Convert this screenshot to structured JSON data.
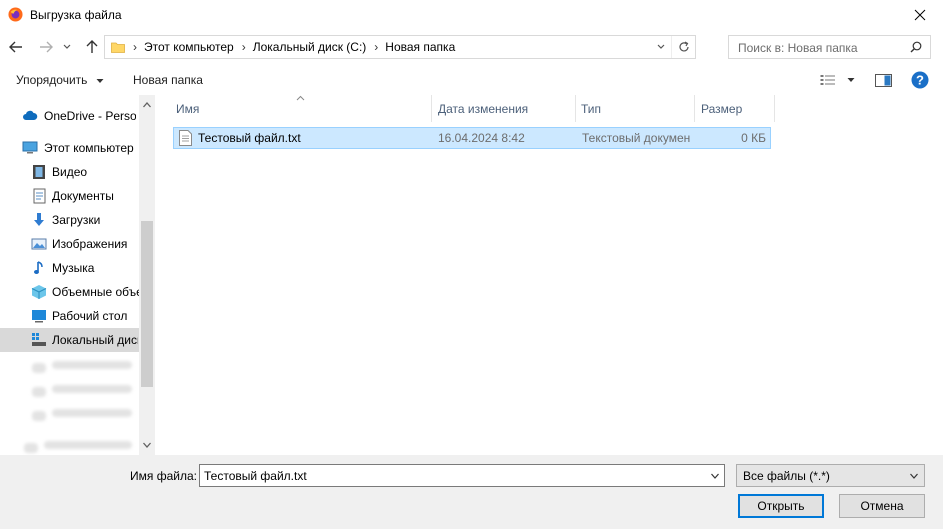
{
  "window": {
    "title": "Выгрузка файла"
  },
  "address": {
    "crumbs": [
      "Этот компьютер",
      "Локальный диск (C:)",
      "Новая папка"
    ]
  },
  "search": {
    "placeholder": "Поиск в: Новая папка"
  },
  "commands": {
    "organize": "Упорядочить",
    "new_folder": "Новая папка"
  },
  "nav": {
    "items": [
      {
        "label": "OneDrive - Person",
        "icon": "cloud-icon"
      },
      {
        "label": "Этот компьютер",
        "icon": "computer-icon"
      },
      {
        "label": "Видео",
        "icon": "video-icon"
      },
      {
        "label": "Документы",
        "icon": "documents-icon"
      },
      {
        "label": "Загрузки",
        "icon": "downloads-icon"
      },
      {
        "label": "Изображения",
        "icon": "pictures-icon"
      },
      {
        "label": "Музыка",
        "icon": "music-icon"
      },
      {
        "label": "Объемные объекты",
        "icon": "3d-objects-icon"
      },
      {
        "label": "Рабочий стол",
        "icon": "desktop-icon"
      },
      {
        "label": "Локальный диск (C:)",
        "icon": "drive-icon"
      }
    ]
  },
  "columns": {
    "name": "Имя",
    "date": "Дата изменения",
    "type": "Тип",
    "size": "Размер"
  },
  "files": [
    {
      "name": "Тестовый файл.txt",
      "date": "16.04.2024 8:42",
      "type": "Текстовый документ",
      "size": "0 КБ"
    }
  ],
  "footer": {
    "filename_label": "Имя файла:",
    "filename_value": "Тестовый файл.txt",
    "filetype_value": "Все файлы (*.*)",
    "open_label": "Открыть",
    "cancel_label": "Отмена"
  },
  "colors": {
    "selection": "#cce8ff",
    "accent": "#0078d7",
    "help": "#1a6fc7"
  }
}
